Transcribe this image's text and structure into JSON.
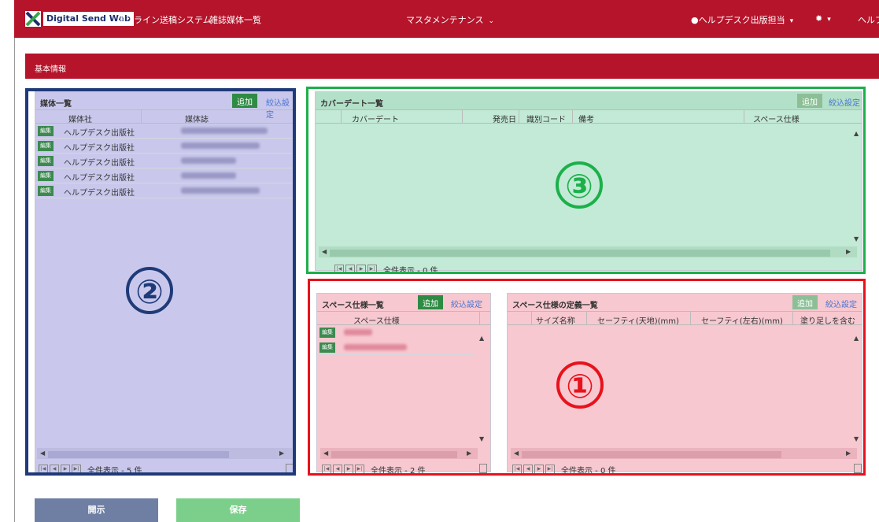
{
  "navbar": {
    "logo_text": "Digital Send Web",
    "system_name": "オンライン送稿システム",
    "page_name": "雑誌媒体一覧",
    "master_menu": "マスタメンテナンス",
    "user_menu": "ヘルプデスク出版担当",
    "help": "ヘルプ"
  },
  "section": {
    "title": "基本情報"
  },
  "media_panel": {
    "title": "媒体一覧",
    "add_label": "追加",
    "filter_label": "絞込設定",
    "columns": [
      "媒体社",
      "媒体誌"
    ],
    "edit_label": "編集",
    "rows": [
      {
        "publisher": "ヘルプデスク出版社"
      },
      {
        "publisher": "ヘルプデスク出版社"
      },
      {
        "publisher": "ヘルプデスク出版社"
      },
      {
        "publisher": "ヘルプデスク出版社"
      },
      {
        "publisher": "ヘルプデスク出版社"
      }
    ],
    "pager_text": "全件表示 - 5 件",
    "annotation": "②"
  },
  "cover_panel": {
    "title": "カバーデート一覧",
    "add_label": "追加",
    "filter_label": "絞込設定",
    "columns": [
      "カバーデート",
      "発売日",
      "識別コード",
      "備考",
      "スペース仕様"
    ],
    "pager_text": "全件表示 - 0 件",
    "annotation": "③"
  },
  "space_panel": {
    "title": "スペース仕様一覧",
    "add_label": "追加",
    "filter_label": "絞込設定",
    "columns": [
      "スペース仕様"
    ],
    "edit_label": "編集",
    "pager_text": "全件表示 - 2 件"
  },
  "space_def_panel": {
    "title": "スペース仕様の定義一覧",
    "add_label": "追加",
    "filter_label": "絞込設定",
    "columns": [
      "サイズ名称",
      "セーフティ(天地)(mm)",
      "セーフティ(左右)(mm)",
      "塗り足しを含む"
    ],
    "pager_text": "全件表示 - 0 件",
    "annotation": "①"
  },
  "footer": {
    "open_label": "開示",
    "save_label": "保存"
  },
  "colors": {
    "brand_red": "#b5142b",
    "frame_blue": "#1f3a78",
    "frame_green": "#1cb04a",
    "frame_red": "#e8121c",
    "fill_blue": "#c9c8ec",
    "fill_green": "#c2ead6",
    "fill_pink": "#f7c8d0",
    "add_green": "#2e8b43"
  }
}
